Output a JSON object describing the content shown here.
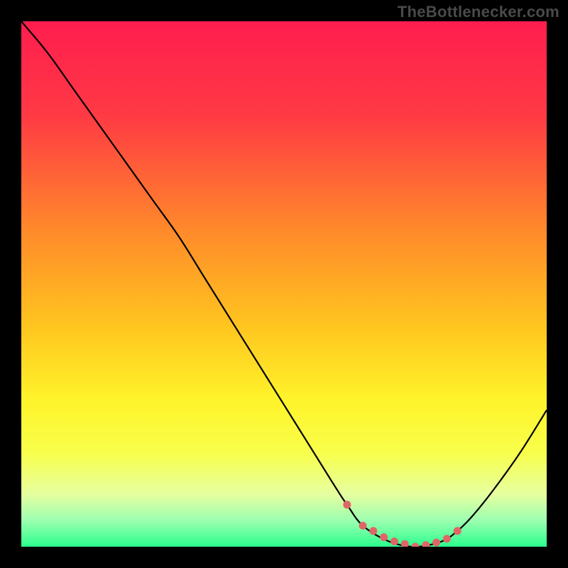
{
  "attribution": "TheBottlenecker.com",
  "chart_data": {
    "type": "line",
    "title": "",
    "xlabel": "",
    "ylabel": "",
    "xlim": [
      0,
      100
    ],
    "ylim": [
      0,
      100
    ],
    "gradient_stops": [
      {
        "offset": 0,
        "color": "#ff1d4f"
      },
      {
        "offset": 18,
        "color": "#ff3a44"
      },
      {
        "offset": 40,
        "color": "#ff8a2a"
      },
      {
        "offset": 58,
        "color": "#ffc51f"
      },
      {
        "offset": 72,
        "color": "#fff32a"
      },
      {
        "offset": 82,
        "color": "#f8ff4a"
      },
      {
        "offset": 90,
        "color": "#e6ffa0"
      },
      {
        "offset": 95,
        "color": "#9cffb0"
      },
      {
        "offset": 100,
        "color": "#2bff8d"
      }
    ],
    "series": [
      {
        "name": "bottleneck-curve",
        "x": [
          0,
          5,
          10,
          15,
          20,
          25,
          30,
          35,
          40,
          45,
          50,
          55,
          60,
          62,
          65,
          70,
          75,
          80,
          83,
          86,
          90,
          95,
          100
        ],
        "y": [
          100,
          94,
          87,
          80,
          73,
          66,
          59,
          51,
          43,
          35,
          27,
          19,
          11,
          8,
          4,
          1,
          0,
          1,
          3,
          6,
          11,
          18,
          26
        ]
      }
    ],
    "markers": {
      "name": "highlight-dots",
      "color": "#e06666",
      "x": [
        62,
        65,
        67,
        69,
        71,
        73,
        75,
        77,
        79,
        81,
        83
      ],
      "y": [
        8,
        4,
        3,
        1.8,
        1,
        0.5,
        0,
        0.3,
        0.8,
        1.5,
        3
      ]
    }
  }
}
